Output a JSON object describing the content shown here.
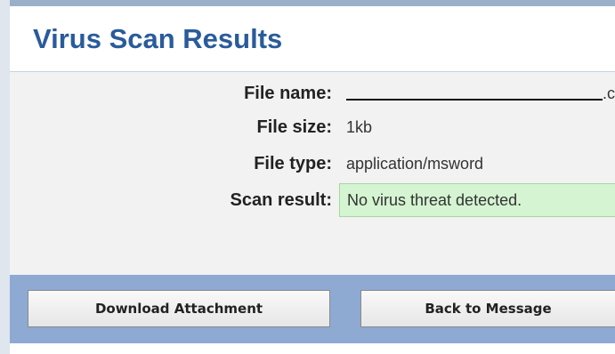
{
  "header": {
    "title": "Virus Scan Results"
  },
  "details": {
    "file_name": {
      "label": "File name:",
      "value_extension": ".c"
    },
    "file_size": {
      "label": "File size:",
      "value": "1kb"
    },
    "file_type": {
      "label": "File type:",
      "value": "application/msword"
    },
    "scan_result": {
      "label": "Scan result:",
      "value": "No virus threat detected."
    }
  },
  "actions": {
    "download_label": "Download Attachment",
    "back_label": "Back to Message"
  },
  "colors": {
    "title": "#2a5b9b",
    "button_bar": "#8eaad3",
    "result_bg": "#d5f4d2",
    "details_bg": "#f2f2f2"
  }
}
